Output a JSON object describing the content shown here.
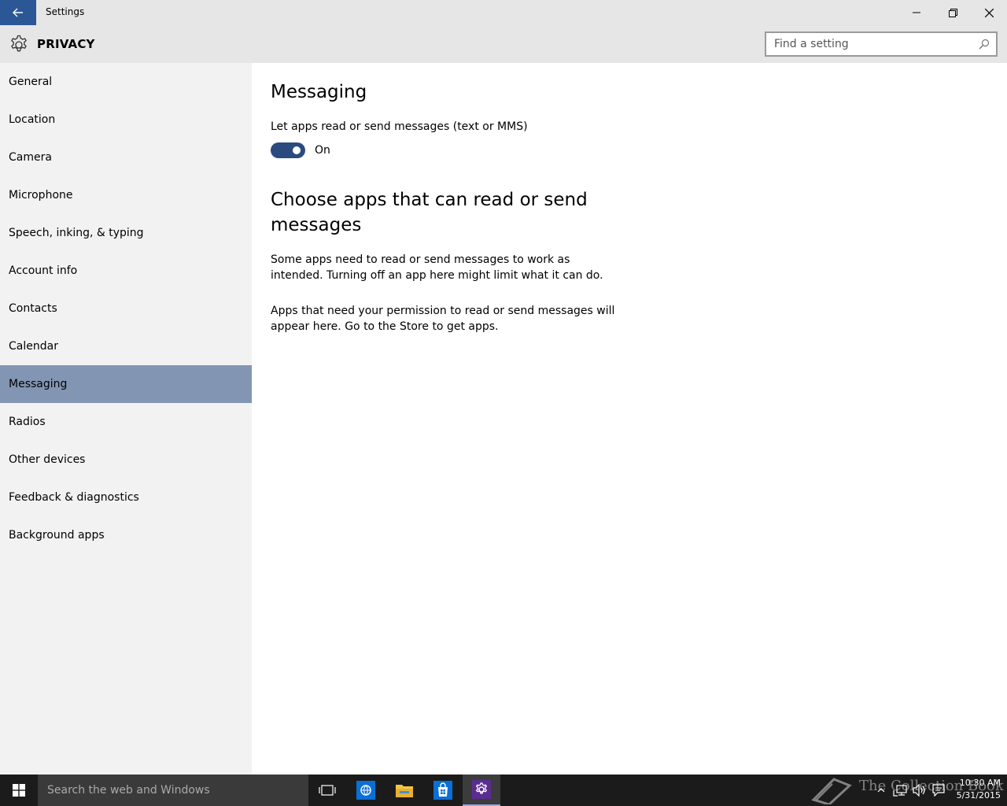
{
  "window": {
    "title": "Settings"
  },
  "header": {
    "title": "PRIVACY",
    "search_placeholder": "Find a setting"
  },
  "sidebar": {
    "items": [
      {
        "label": "General",
        "selected": false
      },
      {
        "label": "Location",
        "selected": false
      },
      {
        "label": "Camera",
        "selected": false
      },
      {
        "label": "Microphone",
        "selected": false
      },
      {
        "label": "Speech, inking, & typing",
        "selected": false
      },
      {
        "label": "Account info",
        "selected": false
      },
      {
        "label": "Contacts",
        "selected": false
      },
      {
        "label": "Calendar",
        "selected": false
      },
      {
        "label": "Messaging",
        "selected": true
      },
      {
        "label": "Radios",
        "selected": false
      },
      {
        "label": "Other devices",
        "selected": false
      },
      {
        "label": "Feedback & diagnostics",
        "selected": false
      },
      {
        "label": "Background apps",
        "selected": false
      }
    ]
  },
  "main": {
    "heading": "Messaging",
    "toggle_description": "Let apps read or send messages (text or MMS)",
    "toggle_state": "On",
    "toggle_on": true,
    "subheading": "Choose apps that can read or send messages",
    "paragraph1": "Some apps need to read or send messages to work as intended. Turning off an app here might limit what it can do.",
    "paragraph2": "Apps that need your permission to read or send messages will appear here. Go to the Store to get apps."
  },
  "taskbar": {
    "search_placeholder": "Search the web and Windows",
    "time": "10:30 AM",
    "date": "5/31/2015",
    "watermark": "The Collection Book"
  },
  "colors": {
    "accent": "#2b5797",
    "selected_nav": "#8295b2",
    "toggle_on": "#2b4b7e",
    "chrome_bg": "#e6e6e6",
    "sidebar_bg": "#f2f2f2",
    "taskbar_bg": "#1b1b1b"
  }
}
